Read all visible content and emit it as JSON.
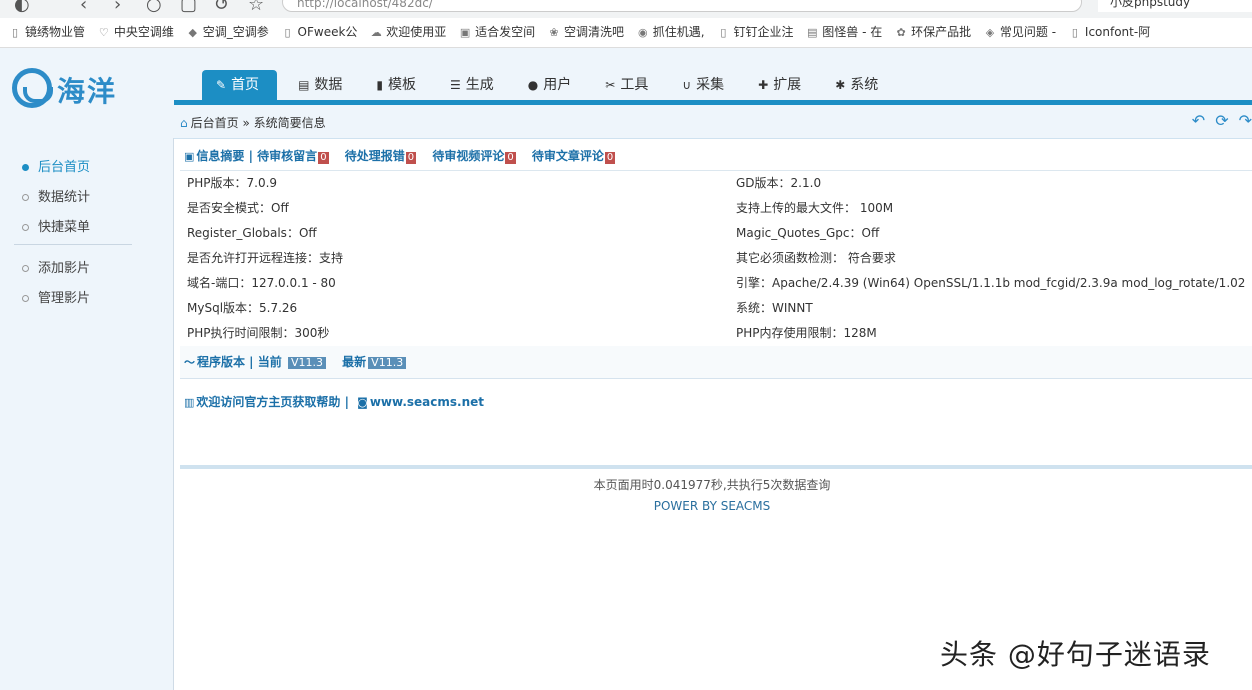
{
  "browser": {
    "address": "http://localhost/482dc/",
    "tab_title": "小皮phpstudy",
    "bookmarks": [
      "镜绣物业管",
      "中央空调维",
      "空调_空调参",
      "OFweek公",
      "欢迎使用亚",
      "适合发空间",
      "空调清洗吧",
      "抓住机遇,",
      "钉钉企业注",
      "图怪兽 - 在",
      "环保产品批",
      "常见问题 -",
      "Iconfont-阿"
    ]
  },
  "logo": {
    "text": "海洋"
  },
  "nav": {
    "tabs": [
      {
        "label": "首页",
        "icon": "✎"
      },
      {
        "label": "数据",
        "icon": "▤"
      },
      {
        "label": "模板",
        "icon": "▮"
      },
      {
        "label": "生成",
        "icon": "☰"
      },
      {
        "label": "用户",
        "icon": "●"
      },
      {
        "label": "工具",
        "icon": "✂"
      },
      {
        "label": "采集",
        "icon": "∪"
      },
      {
        "label": "扩展",
        "icon": "✚"
      },
      {
        "label": "系统",
        "icon": "✱"
      }
    ]
  },
  "breadcrumb": {
    "home": "后台首页",
    "sep": "»",
    "current": "系统简要信息"
  },
  "sidebar": {
    "items": [
      "后台首页",
      "数据统计",
      "快捷菜单",
      "添加影片",
      "管理影片"
    ]
  },
  "summary": {
    "title": "信息摘要",
    "pending_msg": "待审核留言",
    "pending_msg_count": "0",
    "pending_err": "待处理报错",
    "pending_err_count": "0",
    "pending_video": "待审视频评论",
    "pending_video_count": "0",
    "pending_article": "待审文章评论",
    "pending_article_count": "0"
  },
  "info": {
    "rows": [
      {
        "left": "PHP版本：7.0.9",
        "right": "GD版本：2.1.0"
      },
      {
        "left": "是否安全模式：Off",
        "right": "支持上传的最大文件： 100M"
      },
      {
        "left": "Register_Globals：Off",
        "right": "Magic_Quotes_Gpc：Off"
      },
      {
        "left": "是否允许打开远程连接：支持",
        "right": "其它必须函数检测： 符合要求"
      },
      {
        "left": "域名-端口：127.0.0.1 - 80",
        "right": "引擎：Apache/2.4.39 (Win64) OpenSSL/1.1.1b mod_fcgid/2.3.9a mod_log_rotate/1.02"
      },
      {
        "left": "MySql版本：5.7.26",
        "right": "系统：WINNT"
      },
      {
        "left": "PHP执行时间限制：300秒",
        "right": "PHP内存使用限制：128M"
      }
    ]
  },
  "version": {
    "label": "程序版本 | 当前",
    "current": "V11.3",
    "latest_label": "最新",
    "latest": "V11.3"
  },
  "official": {
    "label": "欢迎访问官方主页获取帮助 |",
    "url": "www.seacms.net"
  },
  "footer": {
    "timing": "本页面用时0.041977秒,共执行5次数据查询",
    "power": "POWER BY SEACMS"
  },
  "watermark": "头条 @好句子迷语录"
}
